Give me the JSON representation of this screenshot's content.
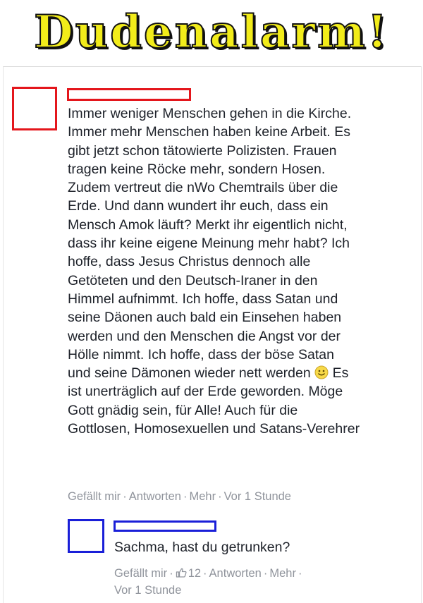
{
  "banner": {
    "title": "Dudenalarm!"
  },
  "comment": {
    "lines": [
      "Immer weniger Menschen gehen in die Kirche.",
      "Immer mehr Menschen haben keine Arbeit. Es",
      "gibt jetzt schon tätowierte Polizisten. Frauen",
      "tragen keine Röcke mehr, sondern Hosen.",
      "Zudem vertreut die nWo Chemtrails über die",
      "Erde. Und dann wundert ihr euch, dass ein",
      "Mensch Amok läuft? Merkt ihr eigentlich nicht,",
      "dass ihr keine eigene Meinung mehr habt? Ich",
      "hoffe, dass Jesus Christus dennoch alle",
      "Getöteten und den Deutsch-Iraner in den",
      "Himmel aufnimmt. Ich hoffe, dass Satan und",
      "seine Däonen auch bald ein Einsehen haben",
      "werden und den Menschen die Angst vor der",
      "Hölle nimmt. Ich hoffe, dass der böse Satan",
      "und seine Dämonen wieder nett werden",
      "Es",
      "ist unerträglich auf der Erde geworden. Möge",
      "Gott gnädig sein, für Alle! Auch für die",
      "Gottlosen, Homosexuellen und Satans-Verehrer"
    ],
    "emoji_icon": "smiley-icon",
    "actions": {
      "like": "Gefällt mir",
      "reply": "Antworten",
      "more": "Mehr",
      "time": "Vor 1 Stunde",
      "separator": "·"
    }
  },
  "reply": {
    "text": "Sachma, hast du getrunken?",
    "actions": {
      "like": "Gefällt mir",
      "like_icon": "thumbs-up-icon",
      "like_count": "12",
      "reply": "Antworten",
      "more": "Mehr",
      "time": "Vor 1 Stunde",
      "separator": "·"
    }
  },
  "colors": {
    "redaction_red": "#e4161c",
    "redaction_blue": "#1a1fd8",
    "banner_yellow": "#f2ec1a",
    "meta_gray": "#90949c",
    "text": "#1d2129"
  }
}
